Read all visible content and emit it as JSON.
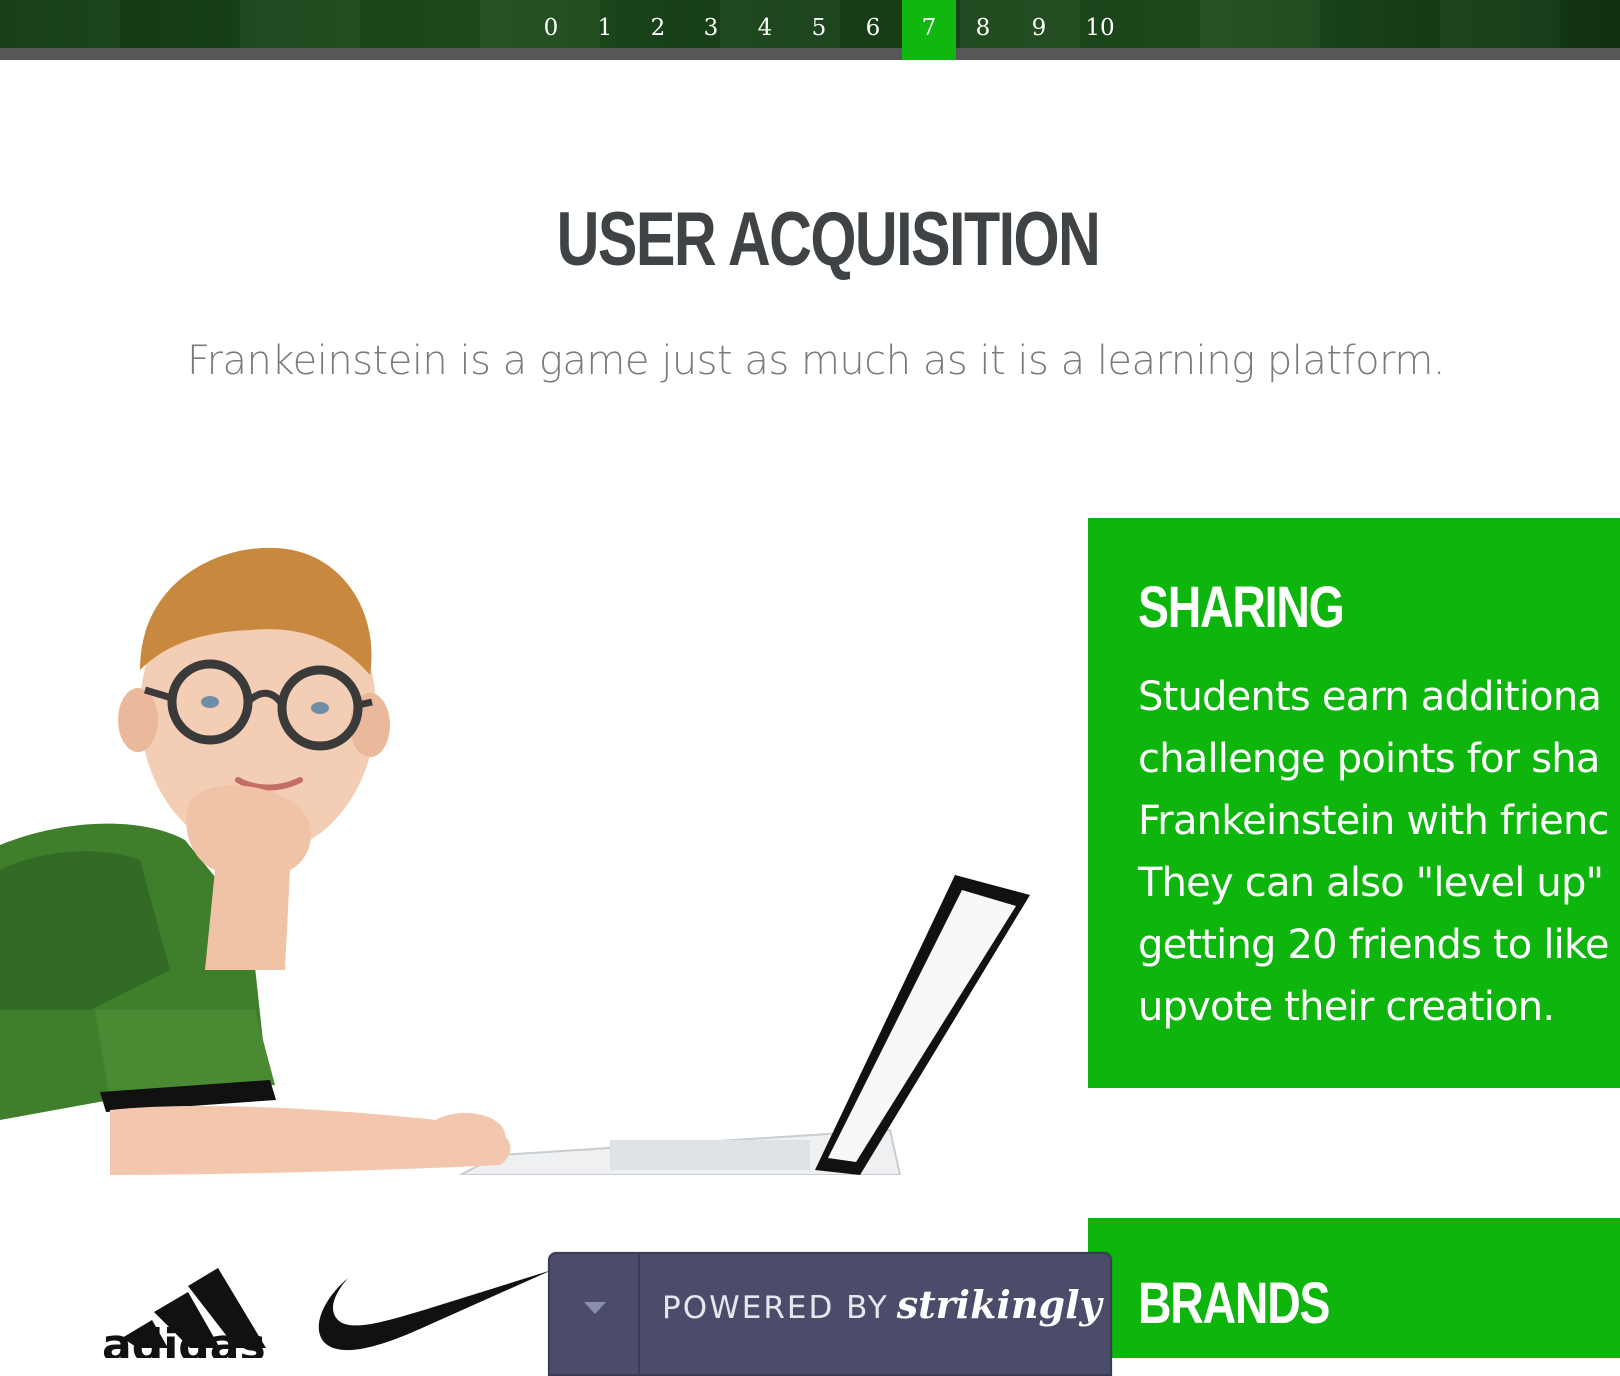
{
  "nav": {
    "items": [
      "0",
      "1",
      "2",
      "3",
      "4",
      "5",
      "6",
      "7",
      "8",
      "9",
      "10"
    ],
    "active_index": 7
  },
  "section": {
    "title": "USER ACQUISITION",
    "subtitle": "Frankeinstein is a game just as much as it is a learning platform."
  },
  "cards": [
    {
      "title": "SHARING",
      "body_lines": [
        "Students earn additiona",
        "challenge points for sha",
        "Frankeinstein with frienc",
        "They can also \"level up\"",
        "getting 20 friends to like",
        "upvote their creation."
      ]
    },
    {
      "title": "BRANDS",
      "body_lines": []
    }
  ],
  "logos": {
    "adidas": "adidas",
    "nike": "swoosh-logo"
  },
  "powered": {
    "label": "POWERED BY",
    "brand": "strikingly"
  },
  "colors": {
    "accent_green": "#0db50c",
    "nav_dark": "#1b4719",
    "badge_bg": "#4a4c6a",
    "title_gray": "#3f4345",
    "subtitle_gray": "#7b7b7b"
  }
}
